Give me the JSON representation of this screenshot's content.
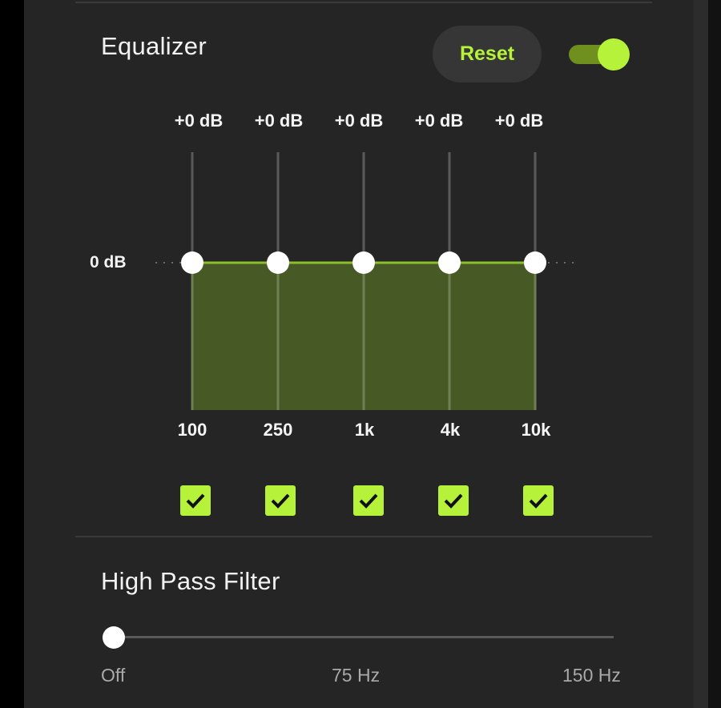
{
  "equalizer": {
    "title": "Equalizer",
    "reset_label": "Reset",
    "enabled": true,
    "zero_label": "0 dB",
    "bands": [
      {
        "freq": "100",
        "gain_label": "+0 dB",
        "gain_db": 0,
        "checked": true
      },
      {
        "freq": "250",
        "gain_label": "+0 dB",
        "gain_db": 0,
        "checked": true
      },
      {
        "freq": "1k",
        "gain_label": "+0 dB",
        "gain_db": 0,
        "checked": true
      },
      {
        "freq": "4k",
        "gain_label": "+0 dB",
        "gain_db": 0,
        "checked": true
      },
      {
        "freq": "10k",
        "gain_label": "+0 dB",
        "gain_db": 0,
        "checked": true
      }
    ]
  },
  "high_pass_filter": {
    "title": "High Pass Filter",
    "value_fraction": 0,
    "tick_labels": [
      "Off",
      "75 Hz",
      "150 Hz"
    ]
  },
  "colors": {
    "accent": "#b6f23a",
    "panel_bg": "#252525",
    "eq_fill": "#475a26",
    "toggle_track": "#6f8f1f"
  }
}
